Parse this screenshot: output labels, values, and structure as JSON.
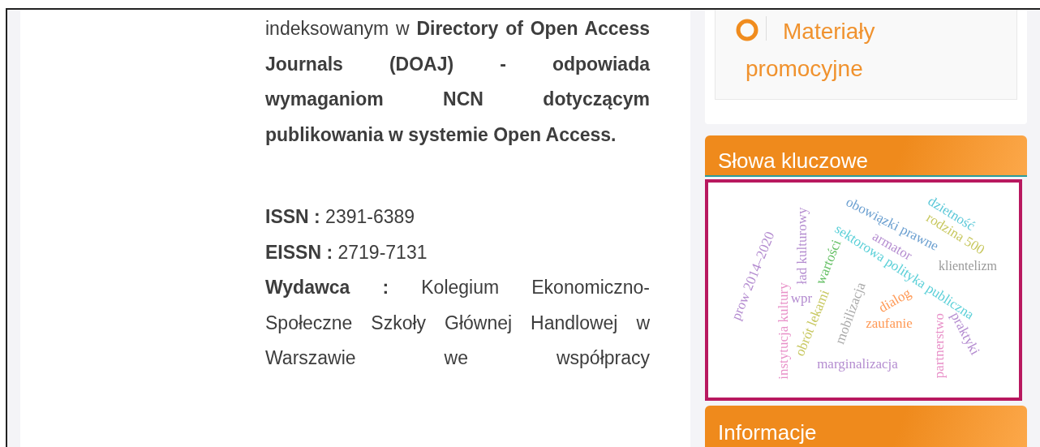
{
  "article": {
    "intro": "indeksowanym w **Directory of Open Access Journals (DOAJ) - odpowiada wymaganiom NCN dotyczącym publikowania w systemie Open Access.**",
    "issn": "**ISSN :** 2391-6389",
    "eissn": "**EISSN :** 2719-7131",
    "publisher": "**Wydawca :** Kolegium Ekonomiczno-Społeczne Szkoły Głównej Handlowej w Warszawie we współpracy"
  },
  "sidebar": {
    "link": "Materiały promocyjne",
    "keywords": {
      "title": "Słowa kluczowe",
      "words": [
        {
          "text": "obowiązki prawne",
          "color": "#6a9fd0"
        },
        {
          "text": "dzietność",
          "color": "#5bc8d8"
        },
        {
          "text": "rodzina 500",
          "color": "#c8c860"
        },
        {
          "text": "armator",
          "color": "#b48cd0"
        },
        {
          "text": "sektorowa polityka publiczna",
          "color": "#5bd0d8"
        },
        {
          "text": "klientelizm",
          "color": "#999999"
        },
        {
          "text": "prow 2014–2020",
          "color": "#b48cd0"
        },
        {
          "text": "ład kulturowy",
          "color": "#b48cd0"
        },
        {
          "text": "wartości",
          "color": "#66c066"
        },
        {
          "text": "wpr",
          "color": "#b48cd0"
        },
        {
          "text": "instytucja kultury",
          "color": "#e890c8"
        },
        {
          "text": "obrót lekami",
          "color": "#c8c860"
        },
        {
          "text": "mobilizacja",
          "color": "#aaaaaa"
        },
        {
          "text": "dialog",
          "color": "#ff9955"
        },
        {
          "text": "zaufanie",
          "color": "#ff9955"
        },
        {
          "text": "partnerstwo",
          "color": "#e890c8"
        },
        {
          "text": "praktyki",
          "color": "#b48cd0"
        },
        {
          "text": "marginalizacja",
          "color": "#b48cd0"
        }
      ]
    },
    "info": {
      "title": "Informacje"
    }
  }
}
